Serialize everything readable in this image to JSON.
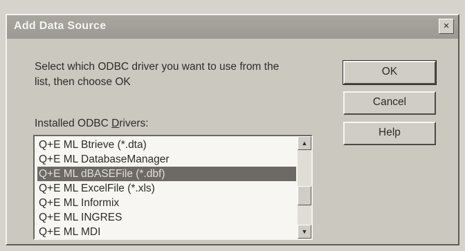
{
  "window": {
    "title": "Add Data Source",
    "close_glyph": "×"
  },
  "prompt": "Select which ODBC driver you want to use from the list, then choose OK",
  "drivers_label": {
    "before": "Installed ODBC ",
    "hotkey": "D",
    "after": "rivers:"
  },
  "buttons": {
    "ok": "OK",
    "cancel": "Cancel",
    "help": "Help"
  },
  "drivers": [
    "Q+E ML Btrieve (*.dta)",
    "Q+E ML DatabaseManager",
    "Q+E ML dBASEFile (*.dbf)",
    "Q+E ML ExcelFile (*.xls)",
    "Q+E ML Informix",
    "Q+E ML INGRES",
    "Q+E ML MDI"
  ],
  "selected_index": 2,
  "scrollbar": {
    "up_icon": "▲",
    "down_icon": "▼"
  }
}
